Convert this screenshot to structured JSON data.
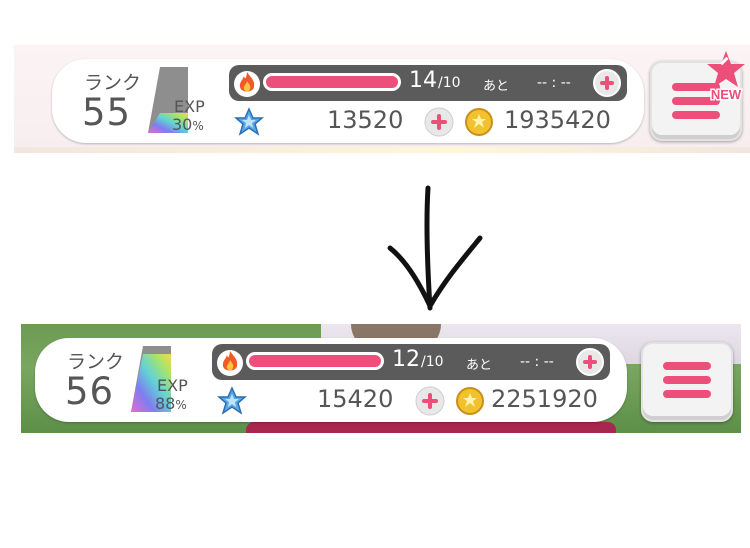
{
  "before": {
    "rank_label": "ランク",
    "rank_value": "55",
    "exp_label": "EXP",
    "exp_value": "30",
    "exp_unit": "%",
    "exp_fraction": 0.3,
    "stamina_current": "14",
    "stamina_max": "/10",
    "stamina_fraction": 1.0,
    "recovery_label": "あと",
    "recovery_timer": "-- : --",
    "jewels": "13520",
    "coins": "1935420",
    "menu_badge": "NEW"
  },
  "after": {
    "rank_label": "ランク",
    "rank_value": "56",
    "exp_label": "EXP",
    "exp_value": "88",
    "exp_unit": "%",
    "exp_fraction": 0.88,
    "stamina_current": "12",
    "stamina_max": "/10",
    "stamina_fraction": 1.0,
    "recovery_label": "あと",
    "recovery_timer": "-- : --",
    "jewels": "15420",
    "coins": "2251920"
  },
  "icons": {
    "stamina": "flame-icon",
    "jewel": "star-icon",
    "coin": "coin-icon",
    "add": "plus-icon",
    "menu": "hamburger-icon",
    "transition": "down-arrow-icon"
  },
  "colors": {
    "accent_pink": "#ec4f7a",
    "bar_dark": "#5b5b5b",
    "text_gray": "#565656",
    "coin_gold": "#f2c12e",
    "star_blue": "#5aa8e6"
  }
}
